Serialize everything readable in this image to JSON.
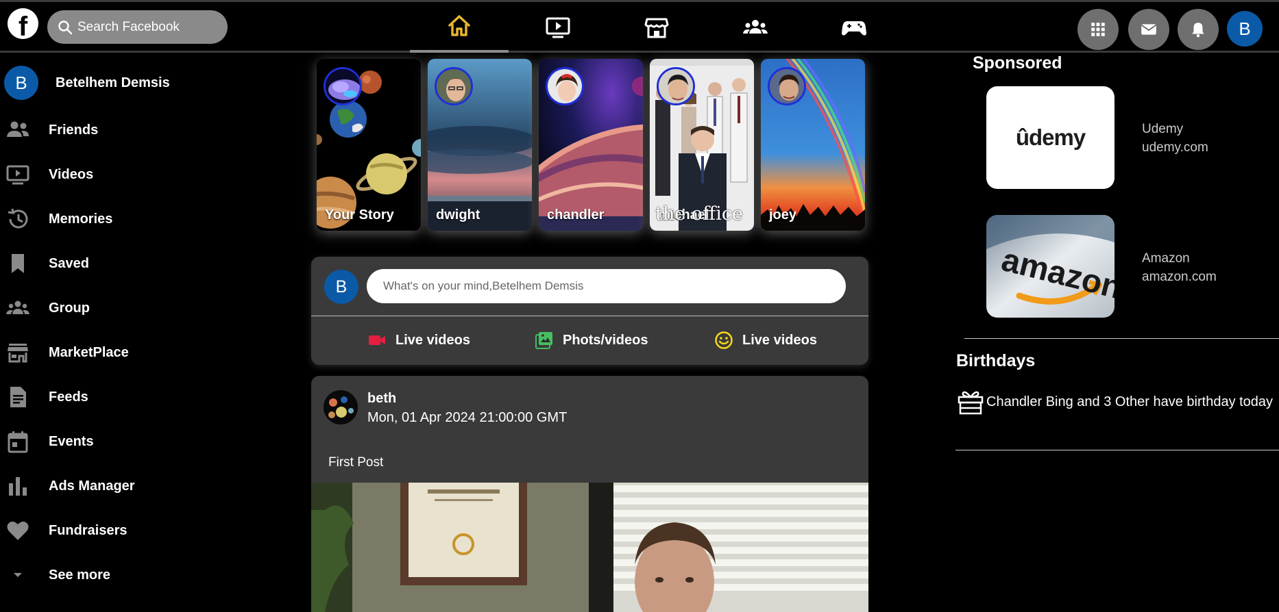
{
  "header": {
    "logo": "f",
    "search_placeholder": "Search Facebook",
    "nav_tabs": [
      {
        "icon": "home-icon",
        "active": true
      },
      {
        "icon": "watch-icon",
        "active": false
      },
      {
        "icon": "marketplace-icon",
        "active": false
      },
      {
        "icon": "groups-icon",
        "active": false
      },
      {
        "icon": "gaming-icon",
        "active": false
      }
    ],
    "right_buttons": [
      "menu-grid-icon",
      "messenger-icon",
      "notifications-icon"
    ],
    "account_initial": "B"
  },
  "sidebar": {
    "profile": {
      "initial": "B",
      "name": "Betelhem Demsis"
    },
    "items": [
      {
        "label": "Friends",
        "icon": "friends-icon"
      },
      {
        "label": "Videos",
        "icon": "videos-icon"
      },
      {
        "label": "Memories",
        "icon": "memories-icon"
      },
      {
        "label": "Saved",
        "icon": "saved-icon"
      },
      {
        "label": "Group",
        "icon": "group-icon"
      },
      {
        "label": "MarketPlace",
        "icon": "store-icon"
      },
      {
        "label": "Feeds",
        "icon": "feeds-icon"
      },
      {
        "label": "Events",
        "icon": "events-icon"
      },
      {
        "label": "Ads Manager",
        "icon": "ads-icon"
      },
      {
        "label": "Fundraisers",
        "icon": "heart-icon"
      },
      {
        "label": "See more",
        "icon": "chevron-down-icon"
      }
    ]
  },
  "stories": [
    {
      "name": "Your Story",
      "overlay": ""
    },
    {
      "name": "dwight",
      "overlay": ""
    },
    {
      "name": "chandler",
      "overlay": ""
    },
    {
      "name": "michael",
      "overlay": "the office"
    },
    {
      "name": "joey",
      "overlay": ""
    }
  ],
  "composer": {
    "initial": "B",
    "placeholder": "What's on your mind,Betelhem Demsis",
    "actions": [
      {
        "label": "Live videos",
        "icon": "live-video-icon",
        "color": "#e41e3f"
      },
      {
        "label": "Phots/videos",
        "icon": "photo-icon",
        "color": "#45bd62"
      },
      {
        "label": "Live videos",
        "icon": "smiley-icon",
        "color": "#f7d917"
      }
    ]
  },
  "post": {
    "author": "beth",
    "date": "Mon, 01 Apr 2024 21:00:00 GMT",
    "text": "First Post"
  },
  "right": {
    "sponsored_title": "Sponsored",
    "ads": [
      {
        "name": "Udemy",
        "url": "udemy.com",
        "logo_text": "ûdemy"
      },
      {
        "name": "Amazon",
        "url": "amazon.com",
        "logo_text": "amazon"
      }
    ],
    "birthdays_title": "Birthdays",
    "birthday_text": "Chandler Bing and 3 Other have birthday today"
  },
  "colors": {
    "background": "#000000",
    "card": "#3a3a3a",
    "home_active": "#e8b62c",
    "avatar_blue": "#0b5aa8",
    "story_ring": "#1f2fd6"
  }
}
